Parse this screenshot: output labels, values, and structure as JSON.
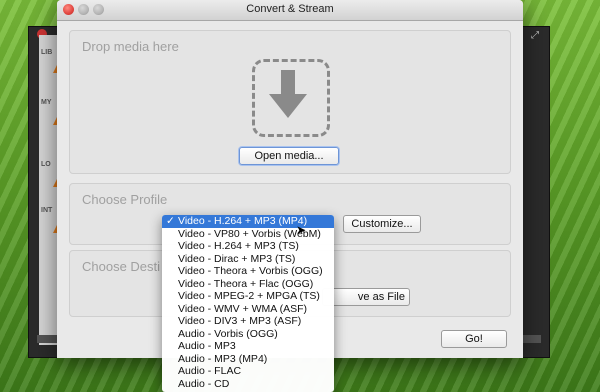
{
  "window": {
    "title": "Convert & Stream"
  },
  "background_window": {
    "sidebar_labels": [
      "LIB",
      "MY",
      "LO",
      "INT"
    ]
  },
  "drop_section": {
    "label": "Drop media here",
    "open_button": "Open media..."
  },
  "profile_section": {
    "label": "Choose Profile",
    "customize_button": "Customize...",
    "menu": {
      "selected_index": 0,
      "items": [
        "Video - H.264 + MP3 (MP4)",
        "Video - VP80 + Vorbis (WebM)",
        "Video - H.264 + MP3 (TS)",
        "Video - Dirac + MP3 (TS)",
        "Video - Theora + Vorbis (OGG)",
        "Video - Theora + Flac (OGG)",
        "Video - MPEG-2 + MPGA (TS)",
        "Video - WMV + WMA (ASF)",
        "Video - DIV3 + MP3 (ASF)",
        "Audio - Vorbis (OGG)",
        "Audio - MP3",
        "Audio - MP3 (MP4)",
        "Audio - FLAC",
        "Audio - CD"
      ]
    }
  },
  "destination_section": {
    "label": "Choose Desti",
    "save_button": "ve as File"
  },
  "go_button": "Go!",
  "colors": {
    "accent": "#3478d8",
    "close": "#e0443e"
  },
  "icons": {
    "drop": "down-arrow-icon",
    "check": "checkmark-icon"
  }
}
